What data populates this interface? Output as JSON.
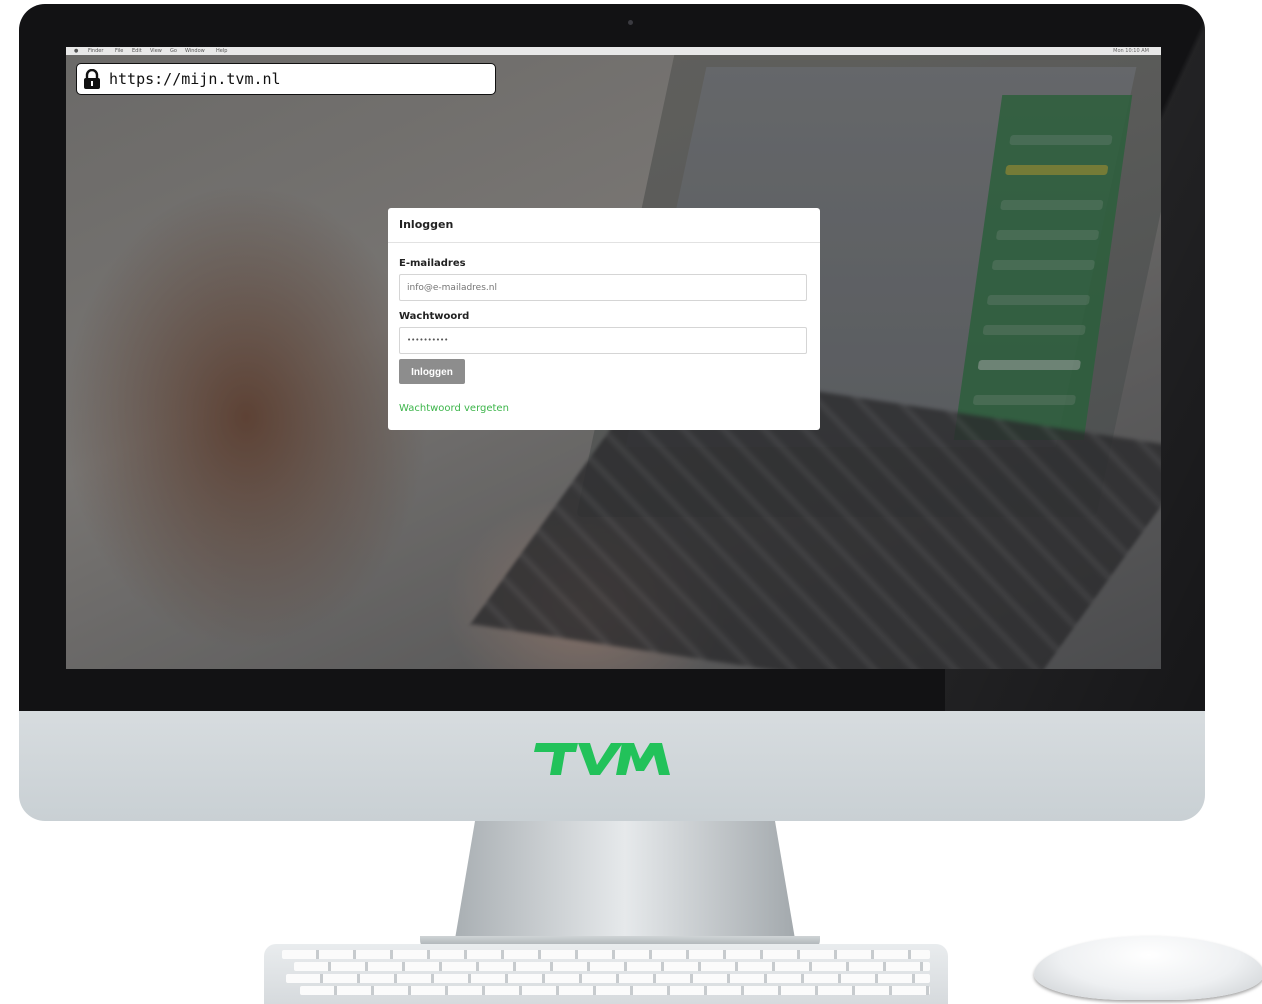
{
  "browser": {
    "url": "https://mijn.tvm.nl"
  },
  "menubar": {
    "items": [
      "Finder",
      "File",
      "Edit",
      "View",
      "Go",
      "Window",
      "Help"
    ],
    "status": "Mon 10:10 AM"
  },
  "login": {
    "title": "Inloggen",
    "email_label": "E-mailadres",
    "email_placeholder": "info@e-mailadres.nl",
    "password_label": "Wachtwoord",
    "password_value": "••••••••••",
    "submit_label": "Inloggen",
    "forgot_link": "Wachtwoord vergeten"
  },
  "brand": {
    "logo_text": "TVM",
    "color": "#22c25a"
  }
}
